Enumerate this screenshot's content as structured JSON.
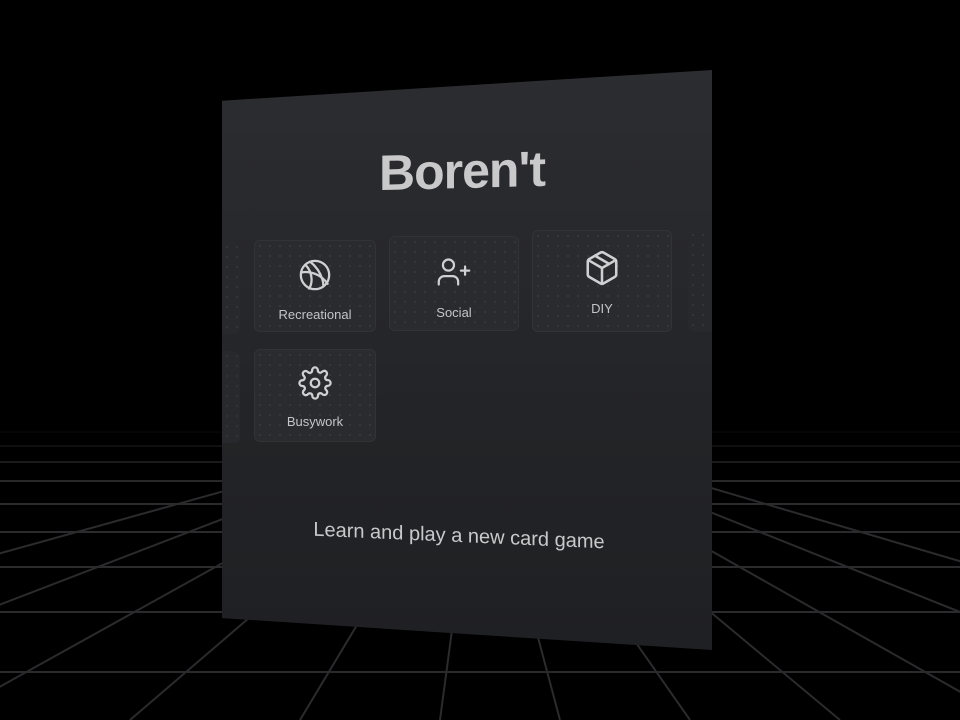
{
  "app": {
    "title": "Boren't",
    "tagline": "Learn and play a new card game"
  },
  "categories": [
    {
      "label": "Recreational",
      "icon": "basketball-icon"
    },
    {
      "label": "Social",
      "icon": "add-user-icon"
    },
    {
      "label": "DIY",
      "icon": "package-box-icon"
    },
    {
      "label": "Busywork",
      "icon": "gear-icon"
    }
  ],
  "colors": {
    "background": "#000000",
    "panel": "#26272b",
    "text": "#c9c9cb",
    "grid_line": "#2a2a2c"
  }
}
